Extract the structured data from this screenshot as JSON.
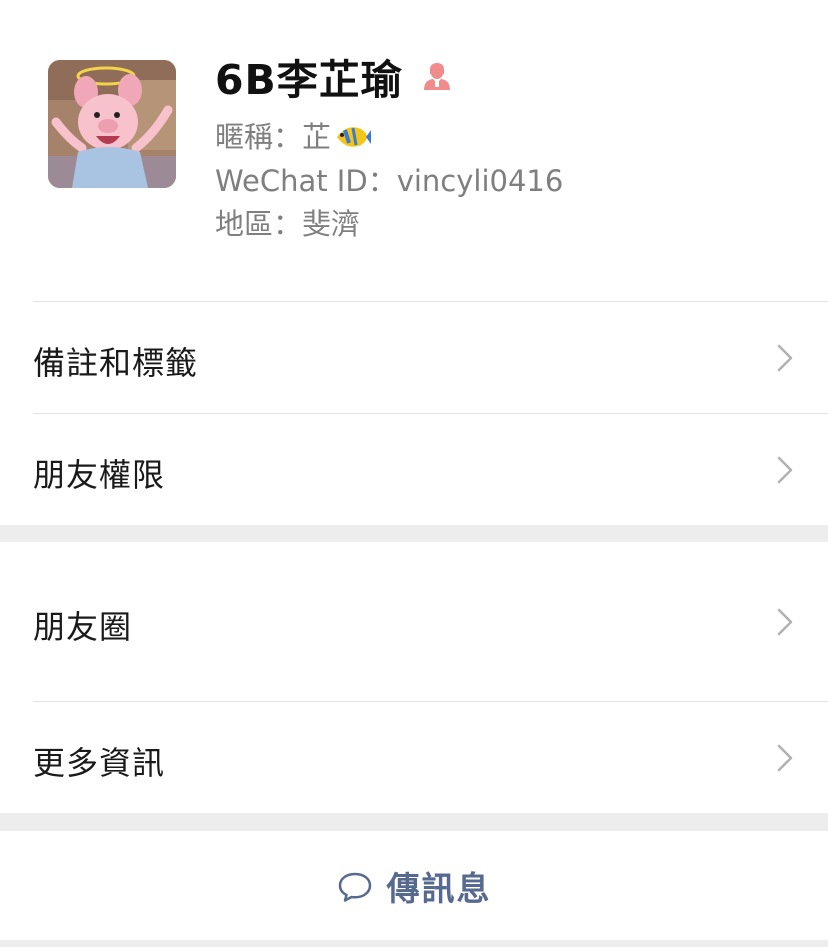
{
  "profile": {
    "name": "6B李芷瑜",
    "gender_icon": "female-icon",
    "gender_color": "#f08c8c",
    "nickname_label": "暱稱：",
    "nickname_value": "芷",
    "nickname_emoji": "tropical-fish-emoji",
    "wechat_id_label": "WeChat ID：",
    "wechat_id_value": "vincyli0416",
    "region_label": "地區：",
    "region_value": "斐濟"
  },
  "menu": {
    "remarks_tags": "備註和標籤",
    "friend_permissions": "朋友權限",
    "moments": "朋友圈",
    "more_info": "更多資訊"
  },
  "actions": {
    "send_message": "傳訊息"
  },
  "colors": {
    "link_blue": "#56698f",
    "background": "#ededed",
    "divider": "#e2e2e2",
    "secondary_text": "#7f7f7f"
  }
}
